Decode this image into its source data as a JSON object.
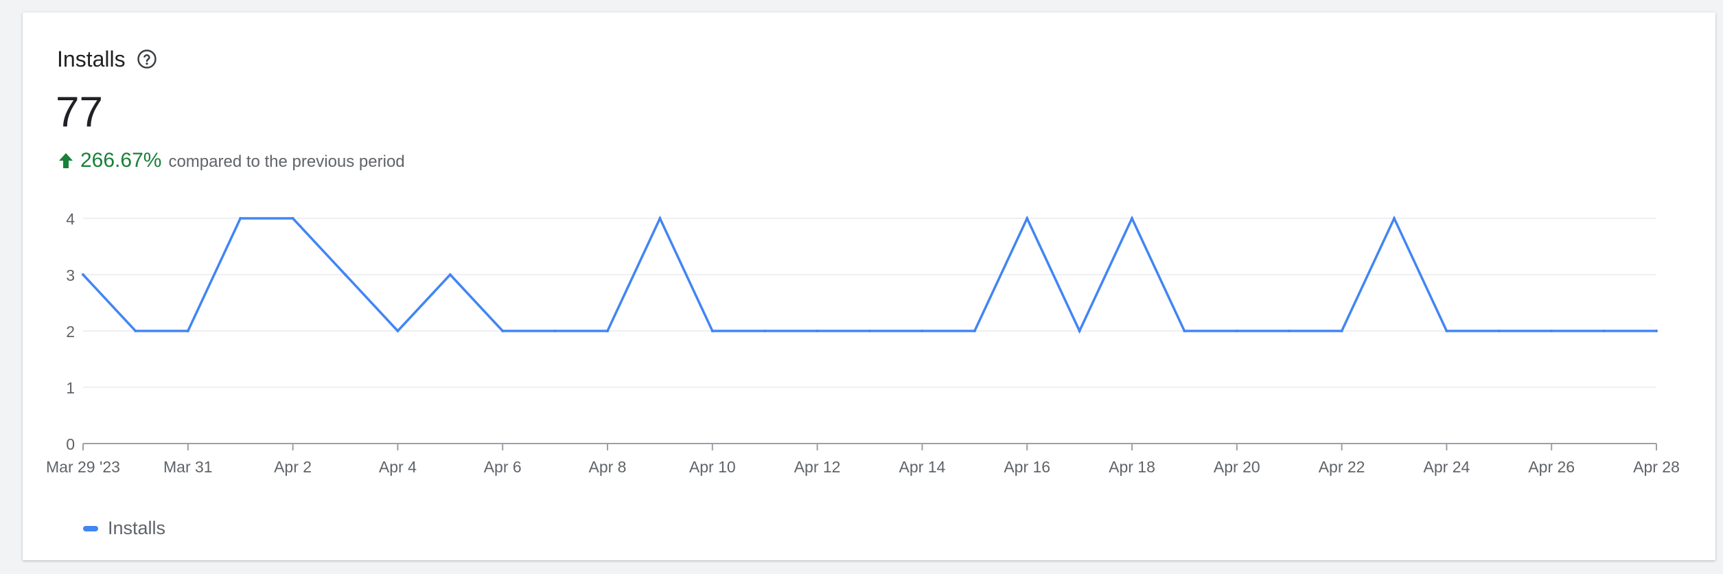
{
  "card": {
    "title": "Installs",
    "help_icon": "help-circle-icon",
    "total": "77",
    "delta_icon": "arrow-up-icon",
    "delta_value": "266.67%",
    "delta_text": "compared to the previous period"
  },
  "colors": {
    "line": "#4285f4",
    "positive": "#188038",
    "grid": "#e8eaed",
    "axis": "#9aa0a6",
    "tick_text": "#5f6368"
  },
  "chart_data": {
    "type": "line",
    "x": [
      "Mar 29 '23",
      "Mar 30",
      "Mar 31",
      "Apr 1",
      "Apr 2",
      "Apr 3",
      "Apr 4",
      "Apr 5",
      "Apr 6",
      "Apr 7",
      "Apr 8",
      "Apr 9",
      "Apr 10",
      "Apr 11",
      "Apr 12",
      "Apr 13",
      "Apr 14",
      "Apr 15",
      "Apr 16",
      "Apr 17",
      "Apr 18",
      "Apr 19",
      "Apr 20",
      "Apr 21",
      "Apr 22",
      "Apr 23",
      "Apr 24",
      "Apr 25",
      "Apr 26",
      "Apr 27",
      "Apr 28"
    ],
    "series": [
      {
        "name": "Installs",
        "values": [
          3,
          2,
          2,
          4,
          4,
          3,
          2,
          3,
          2,
          2,
          2,
          4,
          2,
          2,
          2,
          2,
          2,
          2,
          4,
          2,
          4,
          2,
          2,
          2,
          2,
          4,
          2,
          2,
          2,
          2,
          2
        ]
      }
    ],
    "x_tick_labels": [
      "Mar 29 '23",
      "Mar 31",
      "Apr 2",
      "Apr 4",
      "Apr 6",
      "Apr 8",
      "Apr 10",
      "Apr 12",
      "Apr 14",
      "Apr 16",
      "Apr 18",
      "Apr 20",
      "Apr 22",
      "Apr 24",
      "Apr 26",
      "Apr 28"
    ],
    "y_ticks": [
      0,
      1,
      2,
      3,
      4
    ],
    "ylim": [
      0,
      4
    ],
    "grid": true,
    "legend": "bottom-left"
  }
}
